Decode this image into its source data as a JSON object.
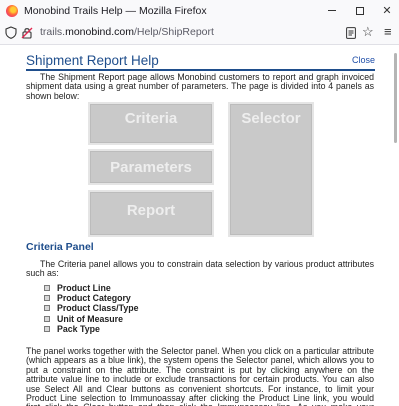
{
  "window": {
    "title": "Monobind Trails Help — Mozilla Firefox",
    "controls": {
      "minimize": "–",
      "maximize": "□",
      "close": "✕"
    }
  },
  "urlbar": {
    "host_prefix": "trails.",
    "host_domain": "monobind.com",
    "path": "/Help/ShipReport"
  },
  "help": {
    "title": "Shipment Report Help",
    "close_label": "Close",
    "intro": "The Shipment Report page allows Monobind customers to report and graph invoiced shipment data using a great number of parameters. The page is divided into 4 panels as shown below:",
    "panels": {
      "criteria": "Criteria",
      "selector": "Selector",
      "parameters": "Parameters",
      "report": "Report"
    },
    "criteria_heading": "Criteria Panel",
    "criteria_intro": "The Criteria panel allows you to constrain data selection by various product attributes such as:",
    "attributes": [
      "Product Line",
      "Product Category",
      "Product Class/Type",
      "Unit of Measure",
      "Pack Type"
    ],
    "criteria_body": "The panel works together with the Selector panel. When you click on a particular attribute (which appears as a blue link), the system opens the Selector panel, which allows you to put a constraint on the attribute. The constraint is put by clicking anywhere on the attribute value line to include or exclude transactions for certain products. You can also use Select All and Clear buttons as convenient shortcuts. For instance, to limit your Product Line selection to Immunoassay after clicking the Product Line link, you would first click the Clear button and then click the Immunoassay line. As you make your selection, the Criteria panel reflects what is"
  }
}
